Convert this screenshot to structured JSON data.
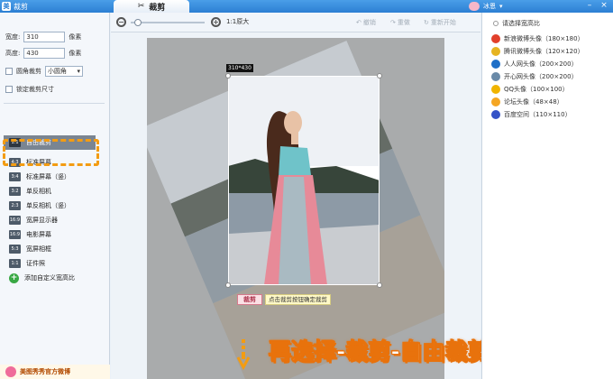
{
  "window": {
    "app_title": "裁剪",
    "center_tab_label": "裁剪",
    "user_name": "冰恩"
  },
  "left_panel": {
    "width_label": "宽度:",
    "width_value": "310",
    "height_label": "高度:",
    "height_value": "430",
    "unit": "像素",
    "round_corner_label": "圆角裁剪",
    "round_corner_option": "小圆角",
    "lock_size_label": "锁定裁剪尺寸",
    "ratio_items": [
      {
        "icon": "1:1",
        "label": "自由裁剪",
        "active": true
      },
      {
        "icon": "4:3",
        "label": "标准屏幕"
      },
      {
        "icon": "3:4",
        "label": "标准屏幕（竖）"
      },
      {
        "icon": "3:2",
        "label": "单反相机"
      },
      {
        "icon": "2:3",
        "label": "单反相机（竖）"
      },
      {
        "icon": "16:9",
        "label": "宽屏显示器"
      },
      {
        "icon": "16:9",
        "label": "电影屏幕"
      },
      {
        "icon": "5:3",
        "label": "宽屏相框"
      },
      {
        "icon": "1:1",
        "label": "证件照"
      }
    ],
    "add_custom_label": "添加自定义宽高比",
    "footer_ad": "美图秀秀官方微博"
  },
  "toolbar": {
    "zoom_value": 0.05,
    "actual_size_label": "1:1原大",
    "undo_label": "撤销",
    "redo_label": "重做",
    "reset_label": "重新开始"
  },
  "canvas": {
    "size_label": "310*430",
    "crop_button_label": "裁剪",
    "hint_text": "点击裁剪按钮确定裁剪",
    "overlay_caption": "再选择-裁剪-自由裁剪"
  },
  "right_panel": {
    "title": "请选择宽高比",
    "sites": [
      {
        "icon": "weibo-icon",
        "label": "新浪微博头像（180×180）",
        "color": "#e2402b"
      },
      {
        "icon": "tencent-weibo-icon",
        "label": "腾讯微博头像（120×120）",
        "color": "#e6b422"
      },
      {
        "icon": "renren-icon",
        "label": "人人网头像（200×200）",
        "color": "#1e6fc7"
      },
      {
        "icon": "kaixin-icon",
        "label": "开心网头像（200×200）",
        "color": "#6a8aa8"
      },
      {
        "icon": "qq-icon",
        "label": "QQ头像（100×100）",
        "color": "#f0b400"
      },
      {
        "icon": "forum-icon",
        "label": "论坛头像（48×48）",
        "color": "#f5a623"
      },
      {
        "icon": "baidu-icon",
        "label": "百度空间（110×110）",
        "color": "#3553c7"
      }
    ]
  },
  "colors": {
    "titlebar": "#2c7fd3",
    "highlight": "#f39c12",
    "caption": "#e8720c"
  }
}
